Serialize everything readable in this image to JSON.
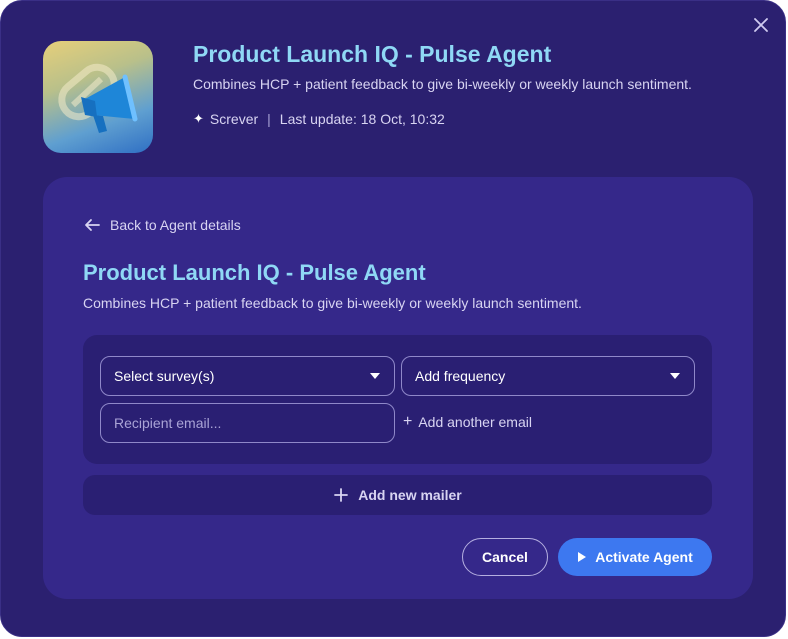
{
  "header": {
    "title": "Product Launch IQ - Pulse Agent",
    "description": "Combines HCP + patient feedback to give bi-weekly or weekly launch sentiment.",
    "author": "Screver",
    "last_update": "Last update: 18 Oct, 10:32",
    "separator": "|",
    "author_icon": "sparkle-icon",
    "hero_icon": "megaphone-icon"
  },
  "card": {
    "back_label": "Back to Agent details",
    "title": "Product Launch IQ - Pulse Agent",
    "description": "Combines HCP + patient feedback to give bi-weekly or weekly launch sentiment."
  },
  "form": {
    "survey_select_label": "Select survey(s)",
    "frequency_select_label": "Add frequency",
    "email_placeholder": "Recipient email...",
    "email_value": "",
    "add_email_label": "Add another email",
    "add_mailer_label": "Add new mailer"
  },
  "actions": {
    "cancel_label": "Cancel",
    "activate_label": "Activate Agent"
  },
  "colors": {
    "modal_bg": "#2b2070",
    "card_bg": "#35288a",
    "panel_bg": "#2a1f73",
    "title_accent": "#8fd8f5",
    "primary_button": "#3d78f0"
  }
}
